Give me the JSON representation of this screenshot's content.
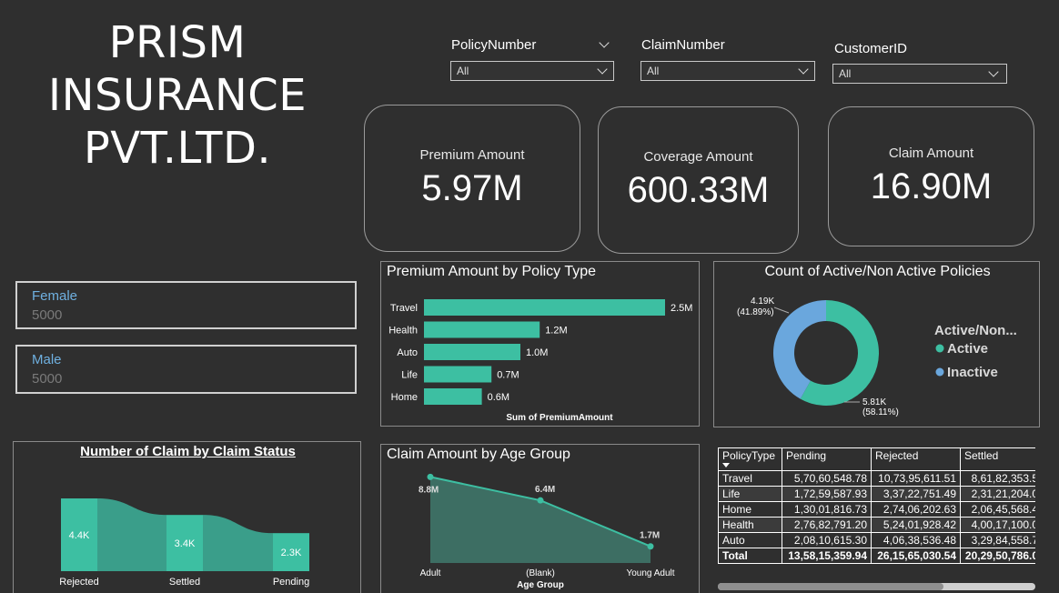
{
  "company": {
    "line1": "PRISM",
    "line2": "INSURANCE",
    "line3": "PVT.LTD."
  },
  "slicers": [
    {
      "label": "PolicyNumber",
      "value": "All"
    },
    {
      "label": "ClaimNumber",
      "value": "All"
    },
    {
      "label": "CustomerID",
      "value": "All"
    }
  ],
  "cards": [
    {
      "label": "Premium Amount",
      "value": "5.97M"
    },
    {
      "label": "Coverage Amount",
      "value": "600.33M"
    },
    {
      "label": "Claim Amount",
      "value": "16.90M"
    }
  ],
  "gender": [
    {
      "label": "Female",
      "value": "5000"
    },
    {
      "label": "Male",
      "value": "5000"
    }
  ],
  "colors": {
    "teal": "#3dbfa2",
    "teal_dark": "#3a9e8a",
    "blue": "#6aa7dd",
    "background": "#2f2f2f"
  },
  "chart_data": [
    {
      "type": "bar",
      "title": "Premium Amount by Policy Type",
      "xlabel": "Sum of PremiumAmount",
      "categories": [
        "Travel",
        "Health",
        "Auto",
        "Life",
        "Home"
      ],
      "values": [
        2.5,
        1.2,
        1.0,
        0.7,
        0.6
      ],
      "labels": [
        "2.5M",
        "1.2M",
        "1.0M",
        "0.7M",
        "0.6M"
      ],
      "unit": "M"
    },
    {
      "type": "pie",
      "title": "Count of Active/Non Active Policies",
      "legend_title": "Active/Non...",
      "categories": [
        "Active",
        "Inactive"
      ],
      "values": [
        5810,
        4190
      ],
      "labels": [
        "5.81K\n(58.11%)",
        "4.19K\n(41.89%)"
      ],
      "label_active_1": "5.81K",
      "label_active_2": "(58.11%)",
      "label_inactive_1": "4.19K",
      "label_inactive_2": "(41.89%)",
      "legend": "right"
    },
    {
      "type": "bar",
      "subtype": "ribbon",
      "title": "Number of Claim by Claim Status",
      "categories": [
        "Rejected",
        "Settled",
        "Pending"
      ],
      "values": [
        4.4,
        3.4,
        2.3
      ],
      "labels": [
        "4.4K",
        "3.4K",
        "2.3K"
      ],
      "unit": "K"
    },
    {
      "type": "area",
      "title": "Claim Amount by Age Group",
      "xlabel": "Age Group",
      "categories": [
        "Adult",
        "(Blank)",
        "Young Adult"
      ],
      "values": [
        8.8,
        6.4,
        1.7
      ],
      "labels": [
        "8.8M",
        "6.4M",
        "1.7M"
      ],
      "unit": "M"
    },
    {
      "type": "table",
      "columns": [
        "PolicyType",
        "Pending",
        "Rejected",
        "Settled"
      ],
      "rows": [
        [
          "Travel",
          "5,70,60,548.78",
          "10,73,95,611.51",
          "8,61,82,353.5"
        ],
        [
          "Life",
          "1,72,59,587.93",
          "3,37,22,751.49",
          "2,31,21,204.0"
        ],
        [
          "Home",
          "1,30,01,816.73",
          "2,74,06,202.63",
          "2,06,45,568.4"
        ],
        [
          "Health",
          "2,76,82,791.20",
          "5,24,01,928.42",
          "4,00,17,100.0"
        ],
        [
          "Auto",
          "2,08,10,615.30",
          "4,06,38,536.48",
          "3,29,84,558.7"
        ]
      ],
      "total": [
        "Total",
        "13,58,15,359.94",
        "26,15,65,030.54",
        "20,29,50,786.0"
      ]
    }
  ]
}
